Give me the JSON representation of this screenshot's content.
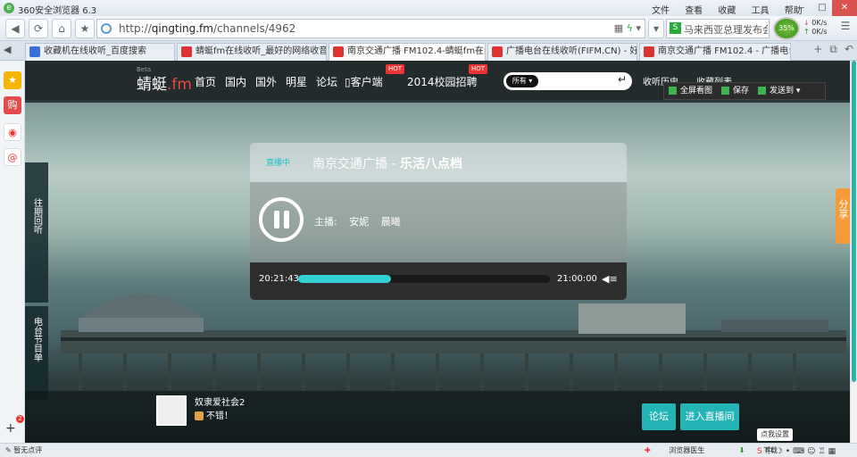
{
  "browser": {
    "window_title": "360安全浏览器 6.3",
    "menu": [
      "文件",
      "查看",
      "收藏",
      "工具",
      "帮助"
    ],
    "address": {
      "prefix": "http://",
      "host": "qingting.fm",
      "path": "/channels/4962"
    },
    "search_value": "马来西亚总理发布会",
    "speed": {
      "percent": "35%",
      "down": "0K/s",
      "up": "0K/s"
    },
    "tabs": [
      {
        "label": "收藏机在线收听_百度搜索",
        "color": "#3a6fd8"
      },
      {
        "label": "蜻蜓fm在线收听_最好的网络收音机",
        "color": "#d33"
      },
      {
        "label": "南京交通广播 FM102.4-蜻蜓fm在线",
        "color": "#d33"
      },
      {
        "label": "广播电台在线收听(FIFM.CN) - 好",
        "color": "#d33"
      },
      {
        "label": "南京交通广播 FM102.4 - 广播电台",
        "color": "#d33"
      }
    ],
    "active_tab": 2,
    "status_left": "暂无点评",
    "status_right": [
      "浏览器医生",
      "下载"
    ]
  },
  "site": {
    "beta": "Beta",
    "brand": "蜻蜓",
    "brand_suffix": ".fm",
    "nav": [
      "首页",
      "国内",
      "国外",
      "明星",
      "论坛",
      "客户端",
      "2014校园招聘"
    ],
    "hot": "HOT",
    "search_select": "所有",
    "history": "收听历史",
    "playlist": "收藏列表",
    "image_tools": [
      "全屏看图",
      "保存",
      "发送到"
    ],
    "side_tabs": [
      "往期回听",
      "电台节目单"
    ],
    "share": "分享"
  },
  "player": {
    "live": "直播中",
    "station": "南京交通广播",
    "separator": " - ",
    "program": "乐活八点档",
    "host_label": "主播:",
    "hosts": [
      "安妮",
      "晨曦"
    ],
    "current_time": "20:21:43",
    "end_time": "21:00:00",
    "progress": 0.37
  },
  "comment": {
    "user": "奴隶爱社会2",
    "text": "不错！"
  },
  "buttons": {
    "forum": "论坛",
    "enter_live": "进入直播间",
    "settings": "点我设置"
  }
}
